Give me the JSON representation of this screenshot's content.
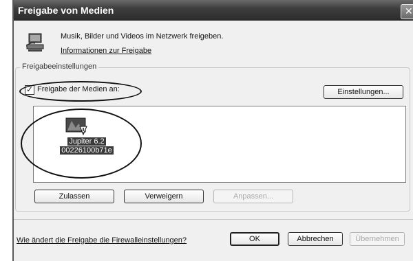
{
  "window": {
    "title": "Freigabe von Medien",
    "close_glyph": "✕"
  },
  "intro": {
    "icon": "network-media-icon",
    "text": "Musik, Bilder und Videos im Netzwerk freigeben.",
    "link": "Informationen zur Freigabe"
  },
  "settings": {
    "group_label": "Freigabeeinstellungen",
    "share_checkbox": {
      "label": "Freigabe der Medien an:",
      "checked": true,
      "check_glyph": "✓"
    },
    "settings_button": "Einstellungen...",
    "devices": [
      {
        "icon": "media-device-warning-icon",
        "name_line1": "Jupiter 6.2",
        "name_line2": "00226100b71e",
        "selected": true
      }
    ],
    "buttons": {
      "allow": "Zulassen",
      "deny": "Verweigern",
      "customize": "Anpassen...",
      "customize_enabled": false
    }
  },
  "footer": {
    "firewall_link": "Wie ändert die Freigabe die Firewalleinstellungen?",
    "ok": "OK",
    "cancel": "Abbrechen",
    "apply": "Übernehmen",
    "apply_enabled": false
  }
}
